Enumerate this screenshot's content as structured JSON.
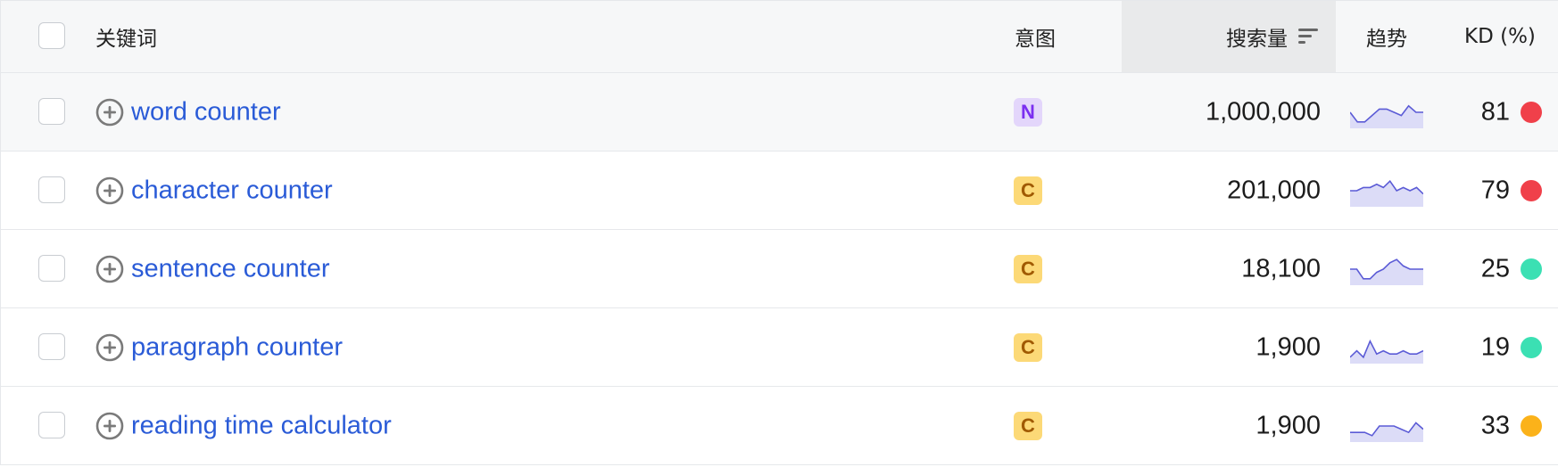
{
  "header": {
    "keyword": "关键词",
    "intent": "意图",
    "volume": "搜索量",
    "trend": "趋势",
    "kd": "KD (%)"
  },
  "colors": {
    "link": "#2a5bd7",
    "kd_red": "#f0404a",
    "kd_green": "#3be0b3",
    "kd_orange": "#fbb21a",
    "intent_n_bg": "#e3d6fb",
    "intent_c_bg": "#fcd977",
    "trend_line": "#5b5bd6",
    "trend_fill": "#dcdcf7"
  },
  "rows": [
    {
      "keyword": "word counter",
      "intent": "N",
      "volume": "1,000,000",
      "kd": "81",
      "kd_color": "#f0404a",
      "trend": [
        5,
        2,
        2,
        4,
        6,
        6,
        5,
        4,
        7,
        5,
        5
      ]
    },
    {
      "keyword": "character counter",
      "intent": "C",
      "volume": "201,000",
      "kd": "79",
      "kd_color": "#f0404a",
      "trend": [
        5,
        5,
        6,
        6,
        7,
        6,
        8,
        5,
        6,
        5,
        6,
        4
      ]
    },
    {
      "keyword": "sentence counter",
      "intent": "C",
      "volume": "18,100",
      "kd": "25",
      "kd_color": "#3be0b3",
      "trend": [
        5,
        5,
        2,
        2,
        4,
        5,
        7,
        8,
        6,
        5,
        5,
        5
      ]
    },
    {
      "keyword": "paragraph counter",
      "intent": "C",
      "volume": "1,900",
      "kd": "19",
      "kd_color": "#3be0b3",
      "trend": [
        2,
        4,
        2,
        7,
        3,
        4,
        3,
        3,
        4,
        3,
        3,
        4
      ]
    },
    {
      "keyword": "reading time calculator",
      "intent": "C",
      "volume": "1,900",
      "kd": "33",
      "kd_color": "#fbb21a",
      "trend": [
        3,
        3,
        3,
        2,
        5,
        5,
        5,
        4,
        3,
        6,
        4
      ]
    }
  ]
}
